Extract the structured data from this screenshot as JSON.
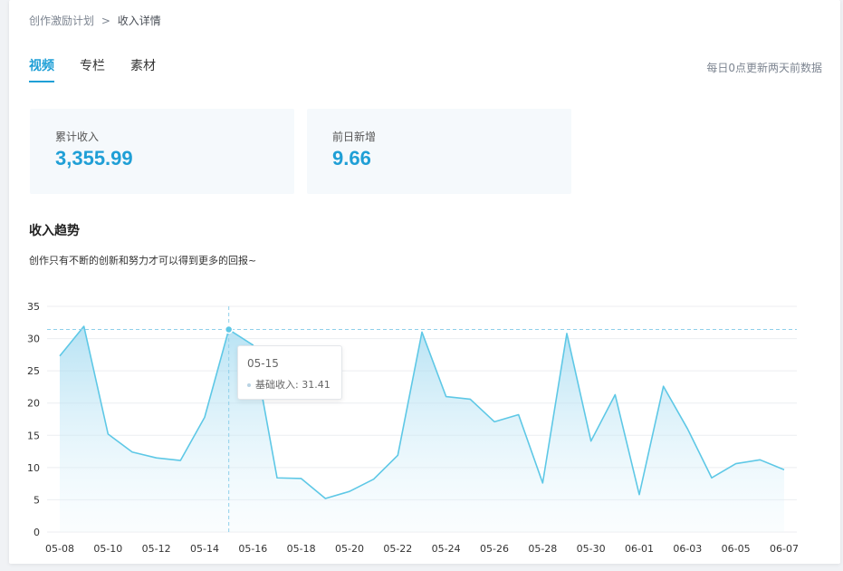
{
  "breadcrumb": {
    "parent": "创作激励计划",
    "separator": ">",
    "current": "收入详情"
  },
  "tabs": [
    {
      "label": "视频",
      "active": true
    },
    {
      "label": "专栏",
      "active": false
    },
    {
      "label": "素材",
      "active": false
    }
  ],
  "update_note": "每日0点更新两天前数据",
  "stats": {
    "total": {
      "label": "累计收入",
      "value": "3,355.99"
    },
    "yesterday": {
      "label": "前日新增",
      "value": "9.66"
    }
  },
  "trend": {
    "title": "收入趋势",
    "subtitle": "创作只有不断的创新和努力才可以得到更多的回报~"
  },
  "tooltip": {
    "date": "05-15",
    "series": "基础收入",
    "value": "31.41"
  },
  "colors": {
    "accent": "#1f9fd6",
    "line": "#5ec8e6"
  },
  "chart_data": {
    "type": "area",
    "x": [
      "05-08",
      "05-09",
      "05-10",
      "05-11",
      "05-12",
      "05-13",
      "05-14",
      "05-15",
      "05-16",
      "05-17",
      "05-18",
      "05-19",
      "05-20",
      "05-21",
      "05-22",
      "05-23",
      "05-24",
      "05-25",
      "05-26",
      "05-27",
      "05-28",
      "05-29",
      "05-30",
      "05-31",
      "06-01",
      "06-02",
      "06-03",
      "06-04",
      "06-05",
      "06-06",
      "06-07"
    ],
    "x_tick_labels": [
      "05-08",
      "05-10",
      "05-12",
      "05-14",
      "05-16",
      "05-18",
      "05-20",
      "05-22",
      "05-24",
      "05-26",
      "05-28",
      "05-30",
      "06-01",
      "06-03",
      "06-05",
      "06-07"
    ],
    "series": [
      {
        "name": "基础收入",
        "values": [
          27.3,
          31.9,
          15.2,
          12.4,
          11.5,
          11.1,
          17.8,
          31.41,
          29.0,
          8.4,
          8.3,
          5.2,
          6.3,
          8.2,
          11.9,
          31.0,
          21.0,
          20.6,
          17.1,
          18.2,
          7.6,
          30.8,
          14.1,
          21.3,
          5.8,
          22.6,
          16.0,
          8.4,
          10.6,
          11.2,
          9.66
        ]
      }
    ],
    "ylim": [
      0,
      35
    ],
    "y_ticks": [
      0,
      5,
      10,
      15,
      20,
      25,
      30,
      35
    ],
    "grid": true,
    "highlight_index": 7
  }
}
